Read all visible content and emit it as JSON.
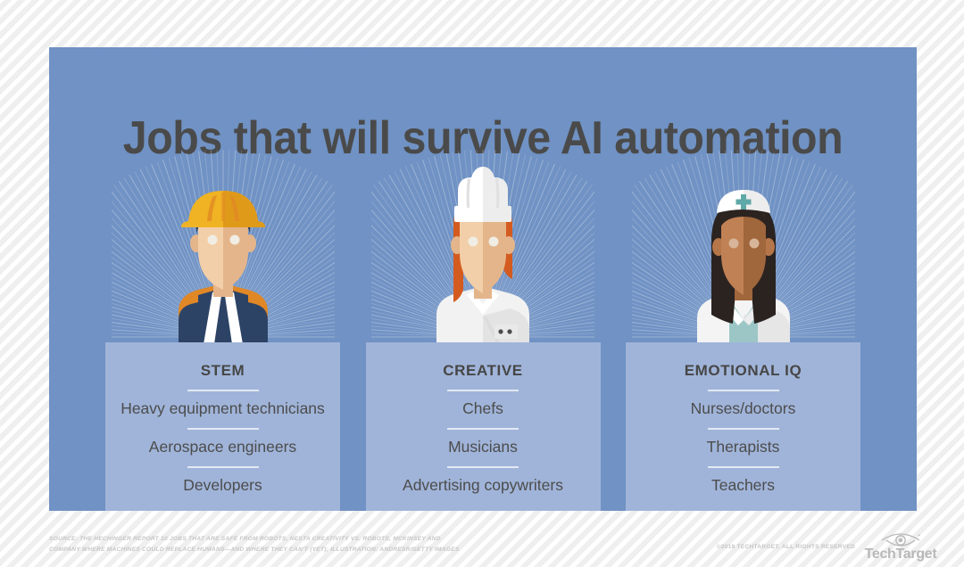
{
  "title": "Jobs that will survive AI automation",
  "colors": {
    "panel_background": "#7092c4",
    "card_background": "#a0b4d9",
    "title_text": "#4a4a4a",
    "divider": "#e2e9f4",
    "page_background": "#f2f2f2",
    "footer_text": "#c6c6c6",
    "hardhat_yellow": "#f0b323",
    "chef_hair_red": "#d45b20",
    "nurse_cross_teal": "#5fa8a8"
  },
  "columns": [
    {
      "id": "stem",
      "heading": "STEM",
      "avatar_icon": "construction-worker-avatar-icon",
      "items": [
        "Heavy equipment technicians",
        "Aerospace engineers",
        "Developers"
      ]
    },
    {
      "id": "creative",
      "heading": "CREATIVE",
      "avatar_icon": "chef-avatar-icon",
      "items": [
        "Chefs",
        "Musicians",
        "Advertising copywriters"
      ]
    },
    {
      "id": "emotional-iq",
      "heading": "EMOTIONAL IQ",
      "avatar_icon": "nurse-avatar-icon",
      "items": [
        "Nurses/doctors",
        "Therapists",
        "Teachers"
      ]
    }
  ],
  "footer": {
    "source_line_1": "SOURCE: THE HECHINGER REPORT 10 JOBS THAT ARE SAFE FROM ROBOTS, NESTA CREATIVITY VS. ROBOTS, MCKINSEY AND",
    "source_line_2": "COMPANY WHERE MACHINES COULD REPLACE HUMANS—AND WHERE THEY CAN'T (YET); ILLUSTRATION: ANDRESR/GETTY IMAGES",
    "copyright": "©2018 TECHTARGET. ALL RIGHTS RESERVED",
    "logo_text": "TechTarget",
    "logo_icon": "techtarget-eye-icon"
  }
}
